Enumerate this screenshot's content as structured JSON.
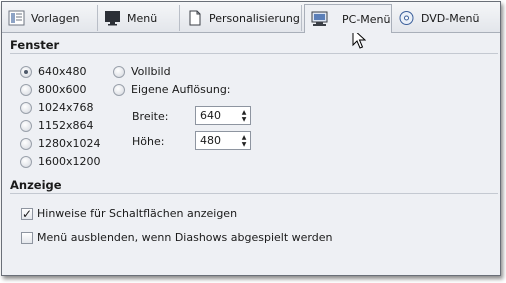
{
  "tabs": [
    {
      "label": "Vorlagen",
      "icon": "templates-icon"
    },
    {
      "label": "Menü",
      "icon": "monitor-icon"
    },
    {
      "label": "Personalisierung",
      "icon": "document-icon"
    },
    {
      "label": "PC-Menü",
      "icon": "pc-menu-icon",
      "active": true
    },
    {
      "label": "DVD-Menü",
      "icon": "dvd-icon"
    }
  ],
  "fenster": {
    "title": "Fenster",
    "resolutions": [
      {
        "label": "640x480",
        "selected": true
      },
      {
        "label": "800x600"
      },
      {
        "label": "1024x768"
      },
      {
        "label": "1152x864"
      },
      {
        "label": "1280x1024"
      },
      {
        "label": "1600x1200"
      }
    ],
    "vollbild": "Vollbild",
    "eigene": "Eigene Auflösung:",
    "breite_label": "Breite:",
    "breite_value": "640",
    "hoehe_label": "Höhe:",
    "hoehe_value": "480"
  },
  "anzeige": {
    "title": "Anzeige",
    "options": [
      {
        "label": "Hinweise für Schaltflächen anzeigen",
        "checked": true
      },
      {
        "label": "Menü ausblenden, wenn Diashows abgespielt werden",
        "checked": false
      }
    ]
  },
  "colors": {
    "accent": "#2f5fa8",
    "panel": "#eef0f4",
    "border": "#6a6f78"
  }
}
